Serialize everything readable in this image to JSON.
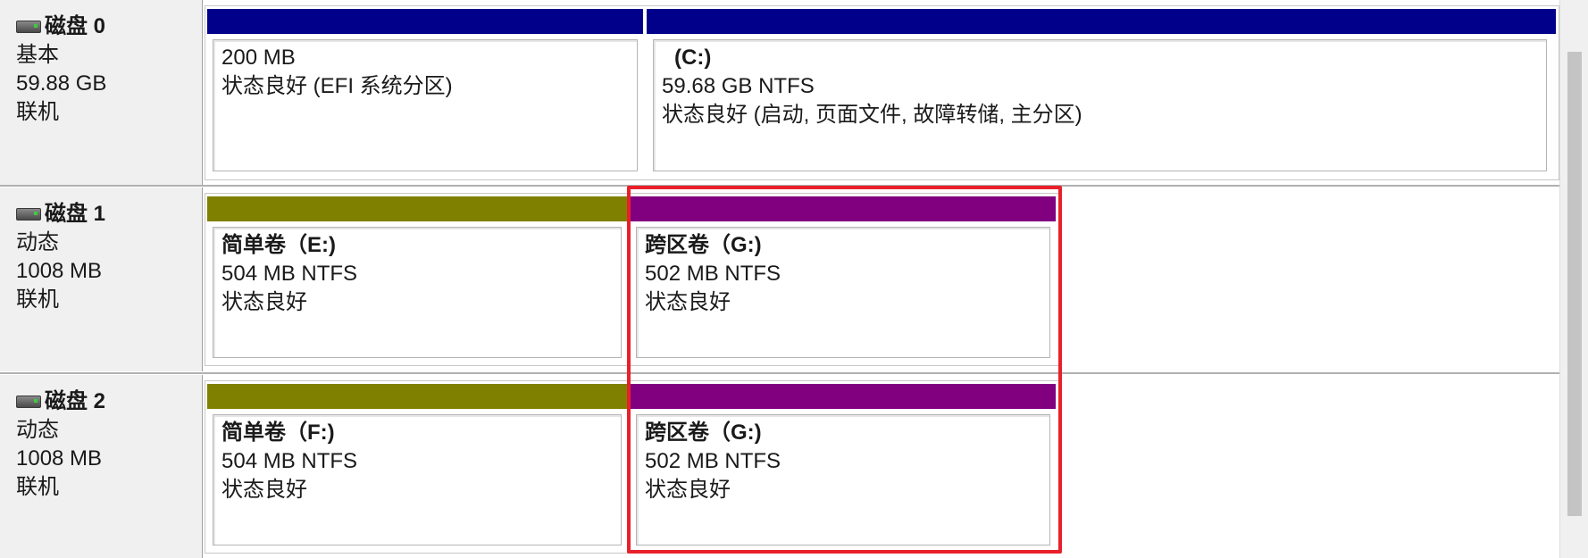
{
  "colors": {
    "primary_bar": "#00008b",
    "simple_bar": "#808000",
    "spanned_bar": "#800080",
    "highlight": "#e8202a"
  },
  "disks": [
    {
      "name": "磁盘 0",
      "type": "基本",
      "size": "59.88 GB",
      "status": "联机",
      "icon": "disk-icon",
      "partitions": [
        {
          "title": "",
          "size": "200 MB",
          "status": "状态良好 (EFI 系统分区)"
        },
        {
          "title": "(C:)",
          "size": "59.68 GB NTFS",
          "status": "状态良好 (启动, 页面文件, 故障转储, 主分区)"
        }
      ]
    },
    {
      "name": "磁盘 1",
      "type": "动态",
      "size": "1008 MB",
      "status": "联机",
      "icon": "disk-icon",
      "partitions": [
        {
          "title": "简单卷（E:)",
          "size": "504 MB NTFS",
          "status": "状态良好"
        },
        {
          "title": "跨区卷（G:)",
          "size": "502 MB NTFS",
          "status": "状态良好"
        }
      ]
    },
    {
      "name": "磁盘 2",
      "type": "动态",
      "size": "1008 MB",
      "status": "联机",
      "icon": "disk-icon",
      "partitions": [
        {
          "title": "简单卷（F:)",
          "size": "504 MB NTFS",
          "status": "状态良好"
        },
        {
          "title": "跨区卷（G:)",
          "size": "502 MB NTFS",
          "status": "状态良好"
        }
      ]
    }
  ]
}
